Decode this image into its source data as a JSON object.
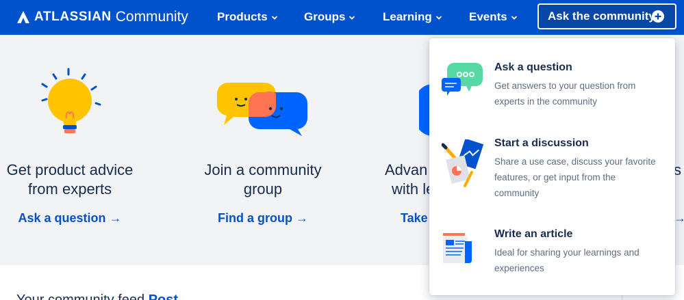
{
  "nav": {
    "brand": "ATLASSIAN",
    "brand_sub": "Community",
    "items": [
      {
        "label": "Products"
      },
      {
        "label": "Groups"
      },
      {
        "label": "Learning"
      },
      {
        "label": "Events"
      }
    ],
    "ask_button": "Ask the community"
  },
  "hero": {
    "cards": [
      {
        "title_line1": "Get product advice",
        "title_line2": "from experts",
        "link": "Ask a question →"
      },
      {
        "title_line1": "Join a community",
        "title_line2": "group",
        "link": "Find a group →"
      },
      {
        "title_line1": "Advan",
        "title_line2": "with le",
        "link": "Take"
      },
      {
        "title_line1": "s c",
        "title_line2": "",
        "link": "→"
      }
    ]
  },
  "below": {
    "text": "Your community feed",
    "link": "Post"
  },
  "dropdown": {
    "items": [
      {
        "title": "Ask a question",
        "description": "Get answers to your question from experts in the community",
        "icon": "chat-bubbles-icon"
      },
      {
        "title": "Start a discussion",
        "description": "Share a use case, discuss your favorite features, or get input from the community",
        "icon": "documents-pencil-icon"
      },
      {
        "title": "Write an article",
        "description": "Ideal for sharing your learnings and experiences",
        "icon": "article-icon"
      }
    ]
  },
  "colors": {
    "brand_blue": "#0052cc",
    "dark_blue": "#0747a6",
    "hero_bg": "#f2f3f5",
    "text": "#172b4d",
    "muted": "#5e6c84"
  }
}
